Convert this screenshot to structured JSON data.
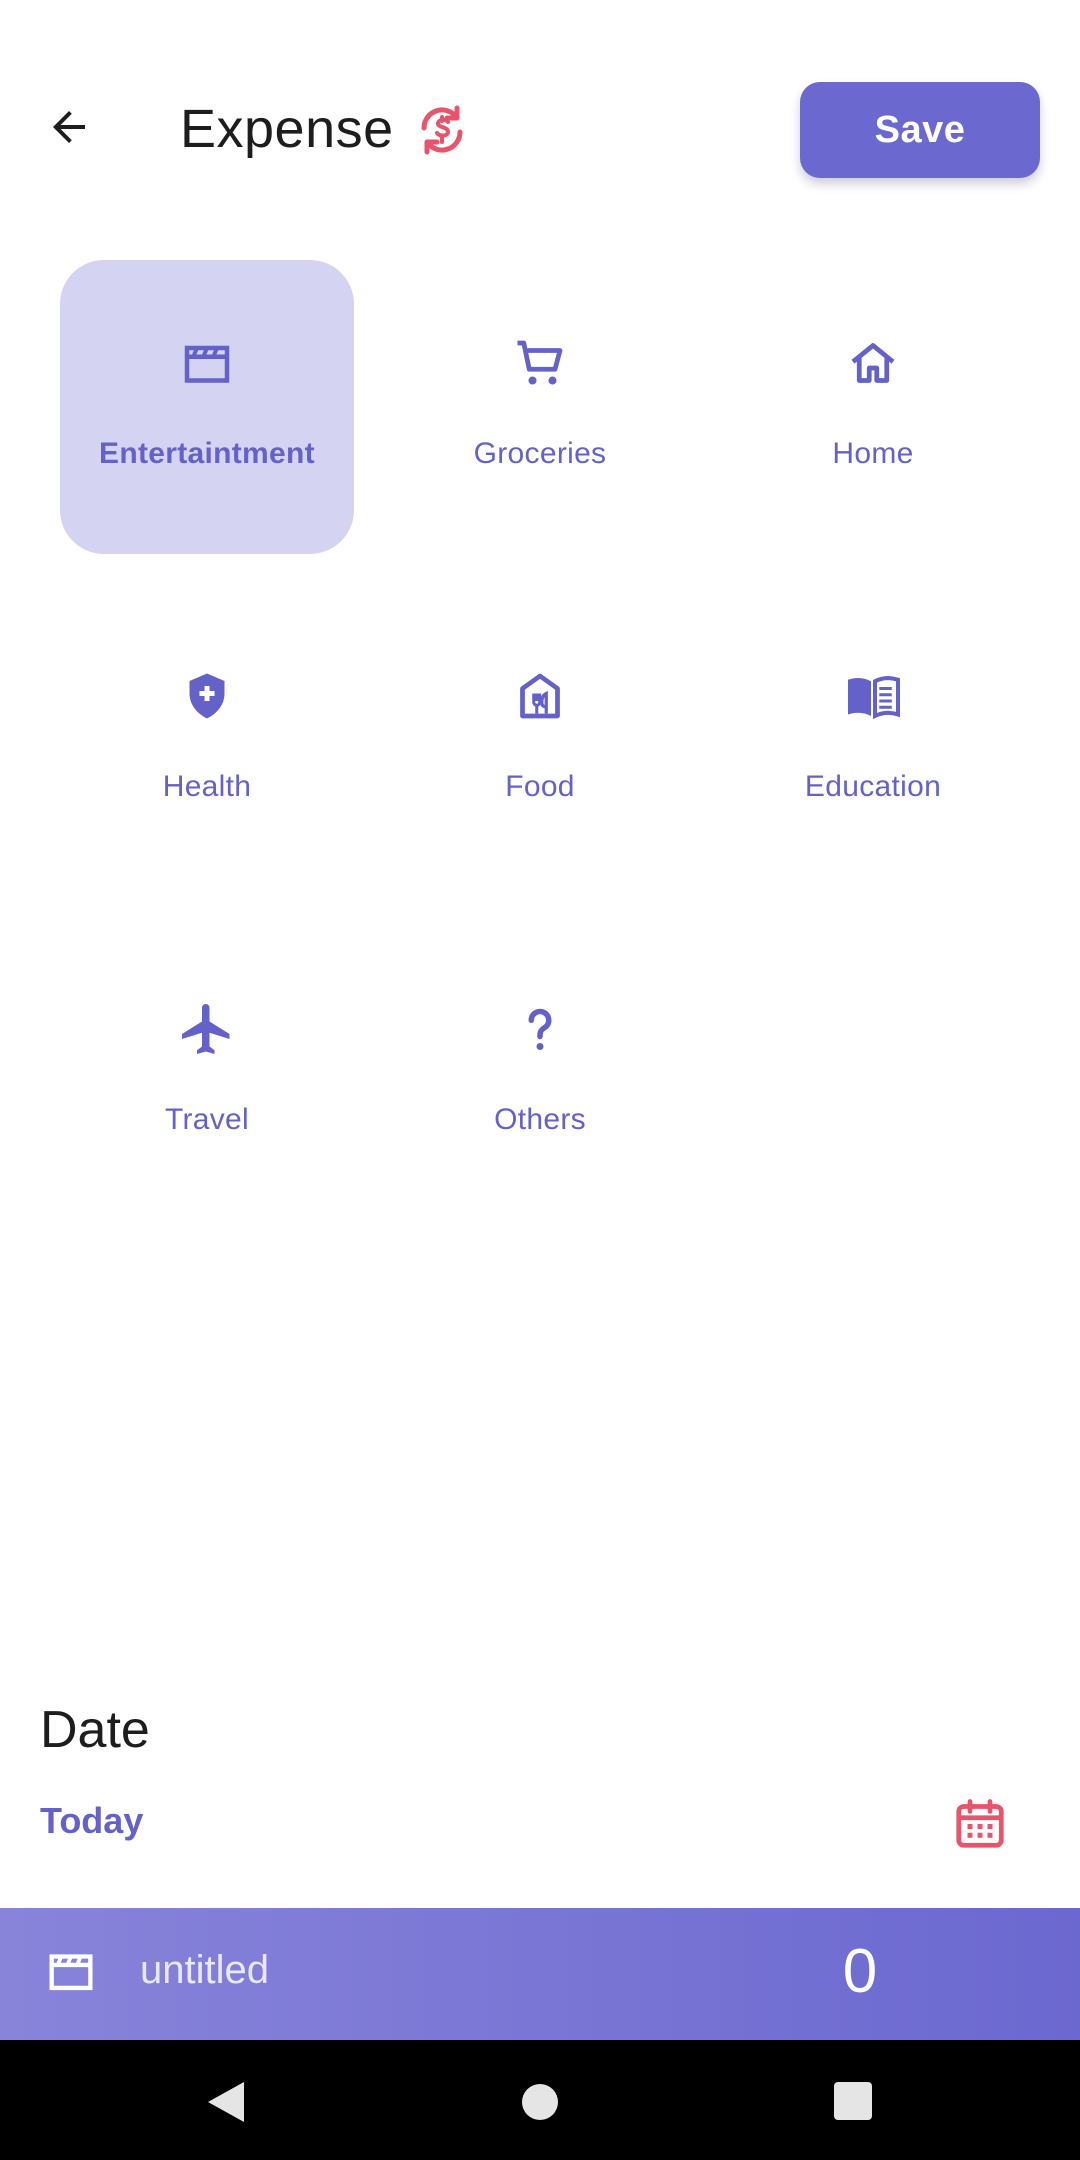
{
  "header": {
    "title": "Expense",
    "save_label": "Save",
    "back_icon": "arrow-left-icon",
    "swap_icon": "currency-swap-icon"
  },
  "categories": [
    {
      "label": "Entertaintment",
      "icon": "clapperboard-icon",
      "selected": true
    },
    {
      "label": "Groceries",
      "icon": "cart-icon",
      "selected": false
    },
    {
      "label": "Home",
      "icon": "home-icon",
      "selected": false
    },
    {
      "label": "Health",
      "icon": "shield-plus-icon",
      "selected": false
    },
    {
      "label": "Food",
      "icon": "restaurant-icon",
      "selected": false
    },
    {
      "label": "Education",
      "icon": "book-open-icon",
      "selected": false
    },
    {
      "label": "Travel",
      "icon": "airplane-icon",
      "selected": false
    },
    {
      "label": "Others",
      "icon": "question-icon",
      "selected": false
    }
  ],
  "date": {
    "title": "Date",
    "value": "Today",
    "picker_icon": "calendar-icon"
  },
  "summary": {
    "icon": "clapperboard-icon",
    "name": "untitled",
    "amount": "0"
  },
  "colors": {
    "accent": "#6b69d0",
    "accent_text": "#6461c8",
    "selected_bg": "#d4d3f2",
    "alert": "#e8546b"
  }
}
